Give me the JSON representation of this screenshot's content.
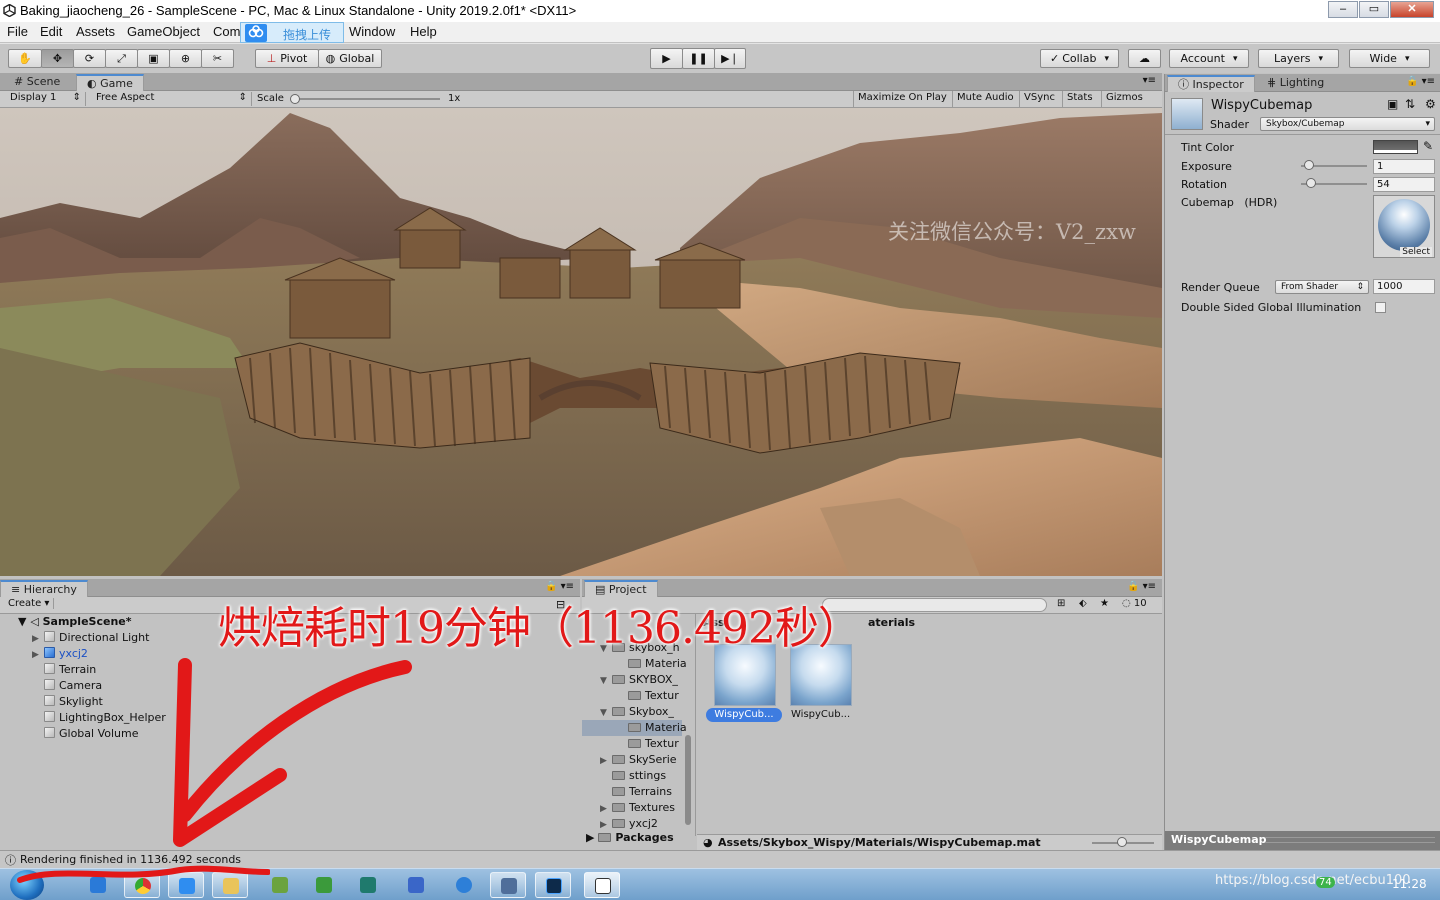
{
  "window": {
    "title": "Baking_jiaocheng_26 - SampleScene - PC, Mac & Linux Standalone - Unity 2019.2.0f1* <DX11>"
  },
  "menu": {
    "file": "File",
    "edit": "Edit",
    "assets": "Assets",
    "gameobject": "GameObject",
    "component": "Com",
    "window": "Window",
    "help": "Help"
  },
  "upload_popup": {
    "label": "拖拽上传"
  },
  "toolbar": {
    "pivot": "Pivot",
    "global": "Global",
    "collab": "Collab",
    "account": "Account",
    "layers": "Layers",
    "layout": "Wide"
  },
  "scene_panel": {
    "tab_scene": "Scene",
    "tab_game": "Game",
    "display": "Display 1",
    "aspect": "Free Aspect",
    "scale_label": "Scale",
    "scale_value": "1x",
    "maximize": "Maximize On Play",
    "mute": "Mute Audio",
    "vsync": "VSync",
    "stats": "Stats",
    "gizmos": "Gizmos",
    "watermark": "关注微信公众号：V2_zxw"
  },
  "hierarchy": {
    "tab": "Hierarchy",
    "create": "Create",
    "scene": "SampleScene*",
    "items": [
      "Directional Light",
      "yxcj2",
      "Terrain",
      "Camera",
      "Skylight",
      "LightingBox_Helper",
      "Global Volume"
    ]
  },
  "project": {
    "tab": "Project",
    "create": "Create",
    "breadcrumb_left": "Ass",
    "breadcrumb_right": "aterials",
    "hidden_count": "10",
    "tree": [
      {
        "name": "skybox_h",
        "indent": 0,
        "open": true
      },
      {
        "name": "Materia",
        "indent": 1,
        "open": false
      },
      {
        "name": "SKYBOX_",
        "indent": 0,
        "open": true
      },
      {
        "name": "Textur",
        "indent": 1,
        "open": false
      },
      {
        "name": "Skybox_",
        "indent": 0,
        "open": true
      },
      {
        "name": "Materia",
        "indent": 1,
        "open": false,
        "selected": true
      },
      {
        "name": "Textur",
        "indent": 1,
        "open": false
      },
      {
        "name": "SkySerie",
        "indent": 0,
        "open": false
      },
      {
        "name": "sttings",
        "indent": 0,
        "open": false
      },
      {
        "name": "Terrains",
        "indent": 0,
        "open": false
      },
      {
        "name": "Textures",
        "indent": 0,
        "open": false
      },
      {
        "name": "yxcj2",
        "indent": 0,
        "open": false
      }
    ],
    "packages": "Packages",
    "assets": [
      "WispyCub...",
      "WispyCub..."
    ],
    "path": "Assets/Skybox_Wispy/Materials/WispyCubemap.mat"
  },
  "inspector": {
    "tab": "Inspector",
    "lighting_tab": "Lighting",
    "material_name": "WispyCubemap",
    "shader_label": "Shader",
    "shader_value": "Skybox/Cubemap",
    "tint_label": "Tint Color",
    "exposure_label": "Exposure",
    "exposure_value": "1",
    "rotation_label": "Rotation",
    "rotation_value": "54",
    "cubemap_label": "Cubemap   (HDR)",
    "select": "Select",
    "queue_label": "Render Queue",
    "queue_mode": "From Shader",
    "queue_value": "1000",
    "dsgi_label": "Double Sided Global Illumination",
    "preview_label": "WispyCubemap",
    "exposure_fraction": 0.125,
    "rotation_fraction": 0.15
  },
  "status": {
    "message": "Rendering finished in 1136.492 seconds"
  },
  "annotation": {
    "text": "烘焙耗时19分钟（1136.492秒）"
  },
  "taskbar": {
    "tray_text": "https://blog.csdn.net/ecbu100",
    "time": "11:28",
    "battery": "74"
  },
  "colors": {
    "accent": "#4d8ad0",
    "annotation": "#e21818",
    "selection": "#3e7ce0"
  }
}
